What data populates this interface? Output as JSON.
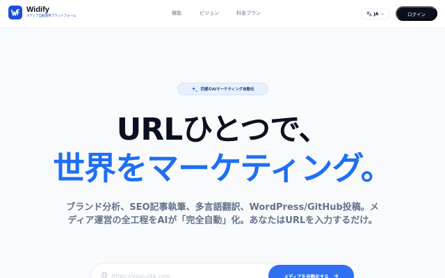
{
  "header": {
    "brand_name": "Widify",
    "brand_tagline": "メディア自動運用プラットフォーム",
    "nav": [
      {
        "label": "機能"
      },
      {
        "label": "ビジョン"
      },
      {
        "label": "料金プラン"
      }
    ],
    "language": {
      "label": "JA",
      "icon": "translate-icon"
    },
    "login_label": "ログイン"
  },
  "hero": {
    "badge_label": "究極のAIマーケティング自動化",
    "headline_line1": "URLひとつで、",
    "headline_line2": "世界をマーケティング。",
    "subcopy": "ブランド分析、SEO記事執筆、多言語翻訳、WordPress/GitHub投稿。メディア運営の全工程をAIが「完全自動」化。あなたはURLを入力するだけ。"
  },
  "url_form": {
    "placeholder": "https://your-site.com",
    "value": "",
    "cta_label": "メディアを自動化する",
    "cta_icon": "arrow-right-icon"
  },
  "colors": {
    "accent": "#1e6ff2",
    "brand": "#1d4ed8",
    "dark": "#0b1020",
    "muted": "#64748b",
    "background": "#f8fafc"
  }
}
